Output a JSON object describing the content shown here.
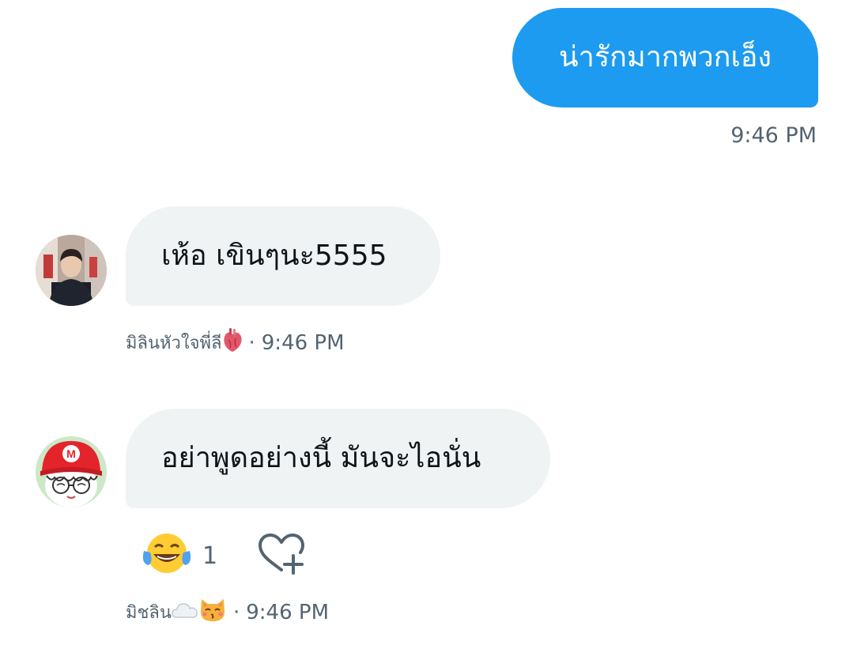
{
  "messages": [
    {
      "direction": "outgoing",
      "text": "น่ารักมากพวกเอ็ง",
      "time": "9:46 PM"
    },
    {
      "direction": "incoming",
      "text": "เห้อ เขินๆนะ5555",
      "sender": "มิลินหัวใจพี่ลี",
      "sender_emoji": "anatomical-heart",
      "separator": "·",
      "time": "9:46 PM",
      "avatar": "photo-avatar"
    },
    {
      "direction": "incoming",
      "text": "อย่าพูดอย่างนี้ มันจะไอนั่น",
      "sender": "มิชลิน",
      "sender_emojis": [
        "cloud",
        "kissing-cat"
      ],
      "separator": "·",
      "time": "9:46 PM",
      "avatar": "cartoon-avatar",
      "reactions": [
        {
          "emoji": "face-with-tears-of-joy",
          "count": "1"
        }
      ],
      "add_reaction_icon": "heart-plus-icon"
    }
  ],
  "colors": {
    "outgoing_bubble": "#1d9bf0",
    "incoming_bubble": "#eff3f4",
    "meta_text": "#536471"
  }
}
